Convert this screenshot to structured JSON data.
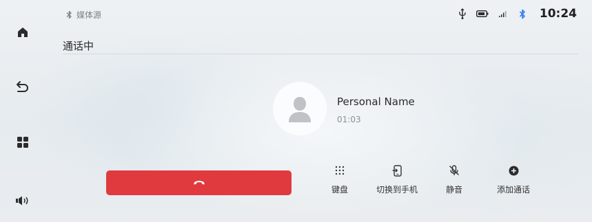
{
  "status_bar": {
    "media_source": "媒体源",
    "time": "10:24"
  },
  "call": {
    "status_title": "通话中",
    "contact_name": "Personal Name",
    "duration": "01:03"
  },
  "actions": [
    {
      "label": "键盘"
    },
    {
      "label": "切换到手机"
    },
    {
      "label": "静音"
    },
    {
      "label": "添加通话"
    }
  ],
  "colors": {
    "end_call": "#e03a3e",
    "accent_bluetooth": "#2f7cf6"
  }
}
